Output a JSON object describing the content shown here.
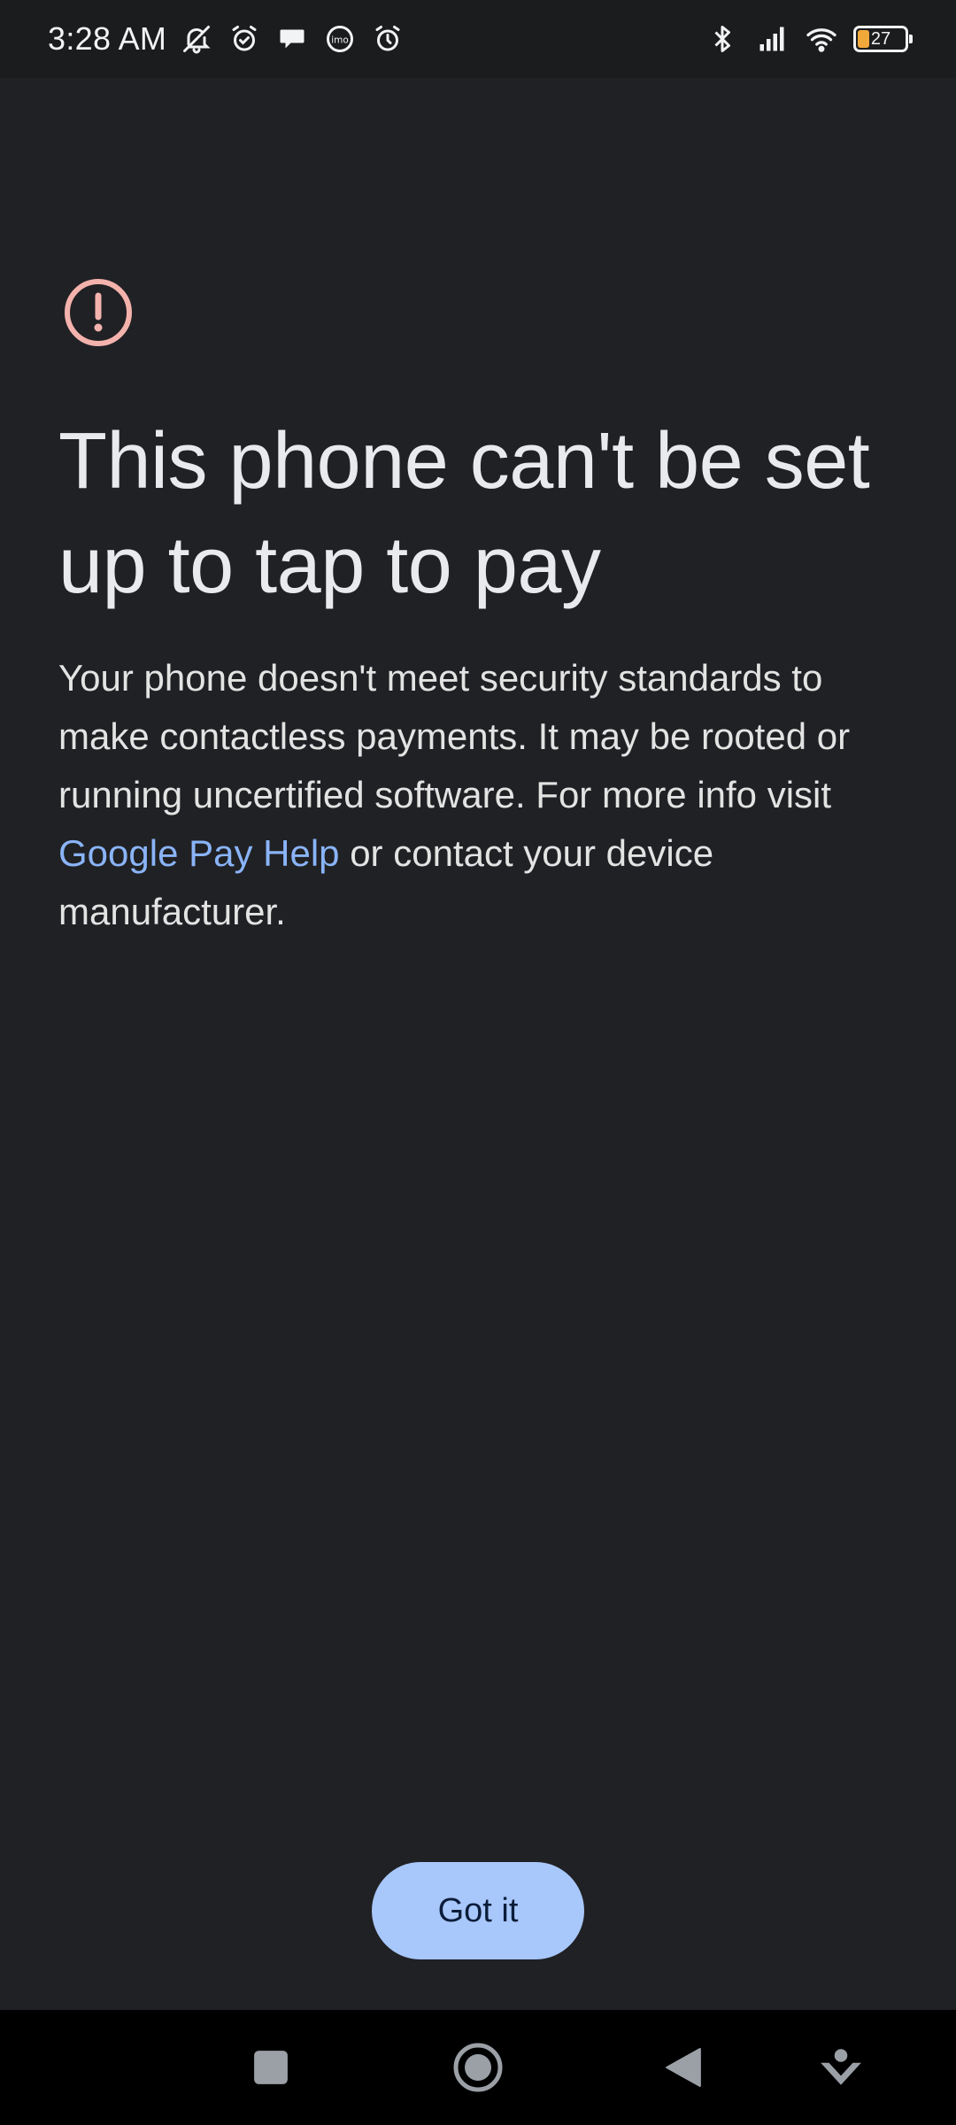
{
  "status_bar": {
    "time": "3:28 AM",
    "left_icons": [
      "bell-muted-icon",
      "alarm-clock-icon",
      "chat-bubble-icon",
      "imo-icon",
      "alarm-icon"
    ],
    "right_icons": [
      "bluetooth-icon",
      "signal-icon",
      "wifi-icon"
    ],
    "battery_level": "27",
    "battery_color": "#f2a93b"
  },
  "dialog": {
    "icon": "alert-circle-icon",
    "icon_color": "#f4b2ad",
    "title": "This phone can't be set up to tap to pay",
    "body_before_link": "Your phone doesn't meet security standards to make contactless payments. It may be rooted or running uncertified software. For more info visit ",
    "link_text": "Google Pay Help",
    "body_after_link": " or contact your device manufacturer.",
    "link_color": "#8ab4f8",
    "button_label": "Got it",
    "button_color": "#a8c7fa"
  },
  "nav_bar": {
    "buttons": [
      "recents-square-icon",
      "home-circle-icon",
      "back-triangle-icon",
      "assistant-down-icon"
    ]
  }
}
